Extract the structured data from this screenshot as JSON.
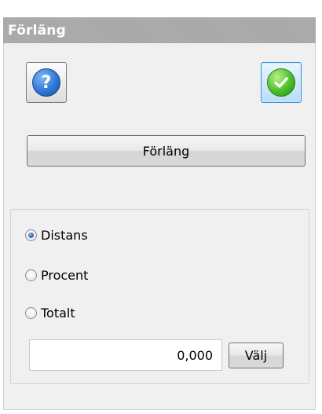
{
  "panel": {
    "title": "Förläng"
  },
  "toolbar": {
    "help_icon": "question-mark-icon",
    "help_glyph": "?",
    "ok_icon": "green-check-icon"
  },
  "action": {
    "extend_label": "Förläng"
  },
  "options": {
    "radios": [
      {
        "label": "Distans",
        "selected": true
      },
      {
        "label": "Procent",
        "selected": false
      },
      {
        "label": "Totalt",
        "selected": false
      }
    ]
  },
  "value": {
    "amount": "0,000",
    "pick_label": "Välj"
  },
  "colors": {
    "titlebar": "#a9a9a9",
    "panel_bg": "#f0f0f0",
    "ok_accent": "#3c8fd8",
    "help_blue": "#2f78d6",
    "check_green": "#4cbf2a"
  }
}
